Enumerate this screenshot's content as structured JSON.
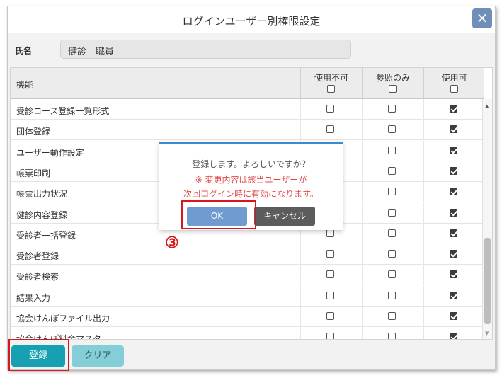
{
  "dialog": {
    "title": "ログインユーザー別権限設定",
    "close_icon": "×"
  },
  "user": {
    "label": "氏名",
    "value": "健診　職員"
  },
  "table": {
    "headers": {
      "feature": "機能",
      "disabled": "使用不可",
      "view_only": "参照のみ",
      "enabled": "使用可"
    },
    "rows": [
      {
        "label": "受診コース登録一覧形式",
        "disabled": false,
        "view_only": false,
        "enabled": true
      },
      {
        "label": "団体登録",
        "disabled": false,
        "view_only": false,
        "enabled": true
      },
      {
        "label": "ユーザー動作設定",
        "disabled": false,
        "view_only": false,
        "enabled": true
      },
      {
        "label": "帳票印刷",
        "disabled": false,
        "view_only": false,
        "enabled": true
      },
      {
        "label": "帳票出力状況",
        "disabled": false,
        "view_only": false,
        "enabled": true
      },
      {
        "label": "健診内容登録",
        "disabled": false,
        "view_only": false,
        "enabled": true
      },
      {
        "label": "受診者一括登録",
        "disabled": false,
        "view_only": false,
        "enabled": true
      },
      {
        "label": "受診者登録",
        "disabled": false,
        "view_only": false,
        "enabled": true
      },
      {
        "label": "受診者検索",
        "disabled": false,
        "view_only": false,
        "enabled": true
      },
      {
        "label": "結果入力",
        "disabled": false,
        "view_only": false,
        "enabled": true
      },
      {
        "label": "協会けんぽファイル出力",
        "disabled": false,
        "view_only": false,
        "enabled": true
      },
      {
        "label": "協会けんぽ料金マスタ",
        "disabled": false,
        "view_only": false,
        "enabled": true
      }
    ]
  },
  "footer": {
    "register_label": "登録",
    "clear_label": "クリア"
  },
  "confirm": {
    "message": "登録します。よろしいですか？",
    "warning_line1": "※ 変更内容は該当ユーザーが",
    "warning_line2": "次回ログイン時に有効になります。",
    "ok_label": "OK",
    "cancel_label": "キャンセル"
  },
  "annotation": {
    "step_label": "③"
  },
  "colors": {
    "accent": "#17a0b1",
    "ok": "#6f9bd1",
    "warning": "#e24a4a",
    "highlight": "#d9161d"
  }
}
